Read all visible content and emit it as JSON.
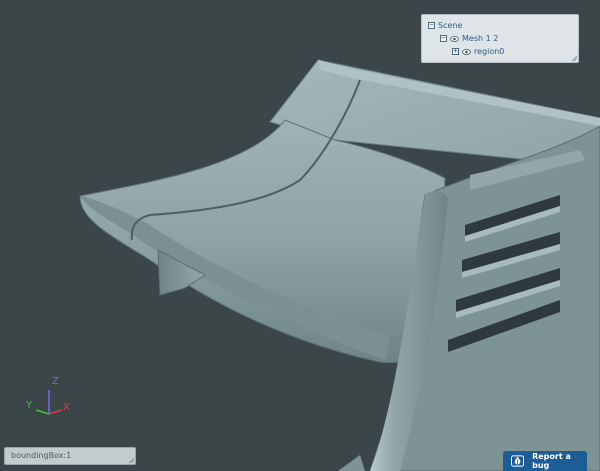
{
  "scene_tree": {
    "root": {
      "label": "Scene",
      "toggle": "⊖"
    },
    "mesh": {
      "label": "Mesh 1 2",
      "toggle": "⊖"
    },
    "region": {
      "label": "region0",
      "toggle": "⊕"
    }
  },
  "status": {
    "bounding_box_label": "boundingBox:1"
  },
  "report_bug": {
    "label": "Report a bug"
  },
  "axis_gizmo": {
    "x_label": "X",
    "y_label": "Y",
    "z_label": "Z",
    "x_color": "#e23a3a",
    "y_color": "#3fbf3f",
    "z_color": "#6a6ee8"
  },
  "colors": {
    "background": "#3b4649",
    "mesh_surface": "#8a9fa0",
    "accent": "#1d5d96"
  },
  "icons": {
    "visibility": "eye-icon",
    "bug": "bug-icon",
    "expand": "expand-icon",
    "collapse": "collapse-icon"
  }
}
